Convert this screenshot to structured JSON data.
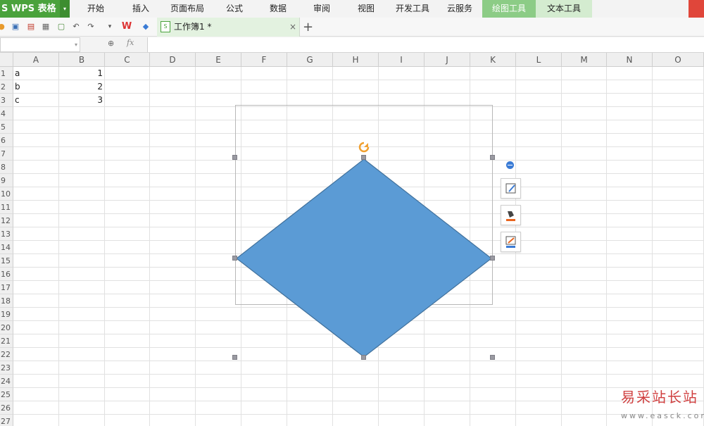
{
  "app": {
    "name": "WPS 表格",
    "name_prefix": "S"
  },
  "menu": {
    "items": [
      "开始",
      "插入",
      "页面布局",
      "公式",
      "数据",
      "审阅",
      "视图",
      "开发工具",
      "云服务"
    ],
    "context_tabs": [
      "绘图工具",
      "文本工具"
    ]
  },
  "toolbar": {
    "icons": [
      "open-icon",
      "save-icon",
      "export-pdf-icon",
      "print-icon",
      "print-preview-icon",
      "undo-icon",
      "redo-icon",
      "customize-dropdown-icon",
      "wps-logo-icon",
      "cube-icon"
    ],
    "document_tab": {
      "title": "工作簿1 *",
      "close": "×"
    },
    "new_tab": "+"
  },
  "formula_bar": {
    "name_box_value": "",
    "fx_label": "fx",
    "formula_value": ""
  },
  "sheet": {
    "columns": [
      "A",
      "B",
      "C",
      "D",
      "E",
      "F",
      "G",
      "H",
      "I",
      "J",
      "K",
      "L",
      "M",
      "N",
      "O"
    ],
    "rows": [
      "1",
      "2",
      "3",
      "4",
      "5",
      "6",
      "7",
      "8",
      "9",
      "10",
      "11",
      "12",
      "13",
      "14",
      "15",
      "16",
      "17",
      "18",
      "19",
      "20",
      "21",
      "22",
      "23",
      "24",
      "25",
      "26",
      "27"
    ],
    "cells": [
      {
        "ref": "A1",
        "value": "a"
      },
      {
        "ref": "B1",
        "value": "1"
      },
      {
        "ref": "A2",
        "value": "b"
      },
      {
        "ref": "B2",
        "value": "2"
      },
      {
        "ref": "A3",
        "value": "c"
      },
      {
        "ref": "B3",
        "value": "3"
      }
    ]
  },
  "shape": {
    "type": "diamond",
    "fill": "#5b9bd5",
    "stroke": "#41719c",
    "handle_color": "#9a9aa2",
    "rotate_color": "#f0a030"
  },
  "float_tools": [
    "collapse-icon",
    "shape-style-icon",
    "fill-icon",
    "outline-icon"
  ],
  "watermark": {
    "title": "易采站长站",
    "url": "www.easck.com"
  }
}
